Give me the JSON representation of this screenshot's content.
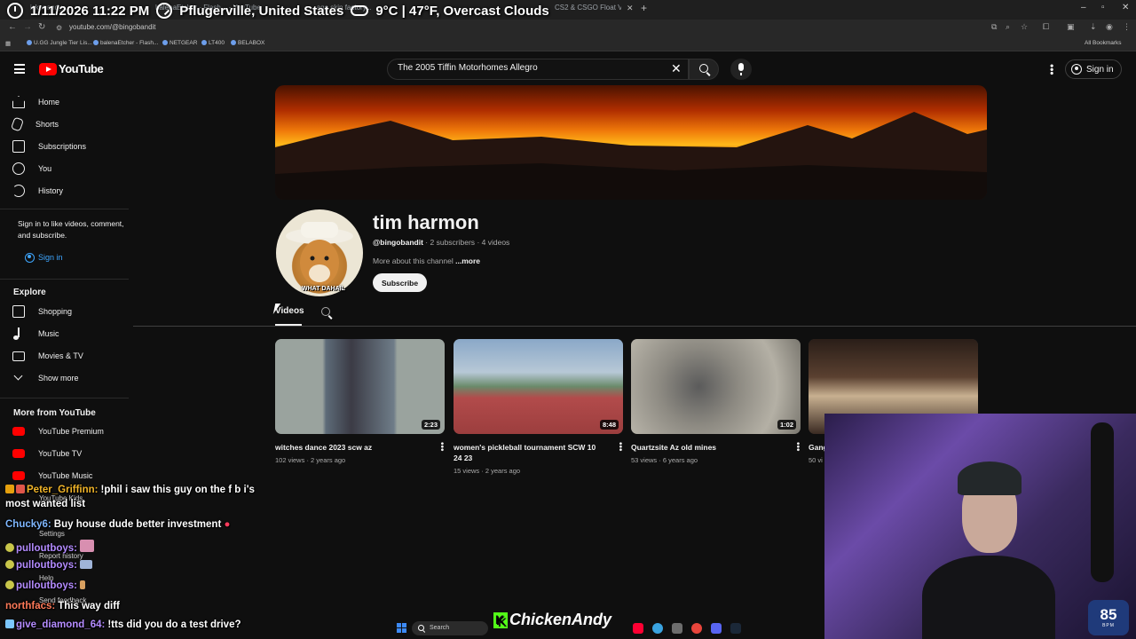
{
  "browser": {
    "url": "youtube.com/@bingobandit",
    "tab_fragments": [
      "ickenandy...",
      "balenaEtcher - Flash... - YouTube",
      "...ago skin factory...",
      "CS2 & CSGO Float Value A..."
    ],
    "bookmarks": [
      "U.GG Jungle Tier Lis...",
      "balenaEtcher - Flash...",
      "NETGEAR",
      "LT400",
      "BELABOX"
    ],
    "all_bookmarks": "All Bookmarks"
  },
  "overlay": {
    "datetime": "1/11/2026 11:22 PM",
    "location": "Pflugerville, United States",
    "weather": "9°C | 47°F, Overcast Clouds"
  },
  "header": {
    "logo_text": "YouTube",
    "search_value": "The 2005 Tiffin Motorhomes Allegro",
    "sign_in": "Sign in"
  },
  "sidebar": {
    "main": [
      {
        "label": "Home",
        "icon": "home-icon"
      },
      {
        "label": "Shorts",
        "icon": "shorts-icon"
      },
      {
        "label": "Subscriptions",
        "icon": "subscriptions-icon"
      },
      {
        "label": "You",
        "icon": "you-icon"
      },
      {
        "label": "History",
        "icon": "history-icon"
      }
    ],
    "signin_prompt": "Sign in to like videos, comment, and subscribe.",
    "signin_label": "Sign in",
    "explore_heading": "Explore",
    "explore": [
      {
        "label": "Shopping",
        "icon": "shopping-icon"
      },
      {
        "label": "Music",
        "icon": "music-icon"
      },
      {
        "label": "Movies & TV",
        "icon": "movies-icon"
      },
      {
        "label": "Show more",
        "icon": "chevron-down-icon"
      }
    ],
    "more_heading": "More from YouTube",
    "more": [
      {
        "label": "YouTube Premium"
      },
      {
        "label": "YouTube TV"
      },
      {
        "label": "YouTube Music"
      },
      {
        "label": "YouTube Kids"
      }
    ],
    "footer": [
      "Settings",
      "Report history",
      "Help",
      "Send feedback"
    ]
  },
  "channel": {
    "name": "tim harmon",
    "handle": "@bingobandit",
    "subscribers": "2 subscribers",
    "videos_count": "4 videos",
    "about": "More about this channel",
    "more_link": "...more",
    "subscribe": "Subscribe",
    "avatar_caption": "WHAT DAHAIL",
    "tab": "Videos"
  },
  "videos": [
    {
      "title": "witches dance 2023 scw az",
      "views": "102 views",
      "age": "2 years ago",
      "duration": "2:23"
    },
    {
      "title": "women's pickleball tournament SCW 10 24 23",
      "views": "15 views",
      "age": "2 years ago",
      "duration": "8:48"
    },
    {
      "title": "Quartzsite Az old mines",
      "views": "53 views",
      "age": "6 years ago",
      "duration": "1:02"
    },
    {
      "title": "Gang",
      "views": "50 vi",
      "age": "",
      "duration": ""
    }
  ],
  "chat": [
    {
      "user": "Peter_Griffinn:",
      "message": "!phil i saw this guy on the f b i's",
      "user_color": "#f0b429"
    },
    {
      "user": "",
      "message": "most wanted list",
      "user_color": "#ffffff"
    },
    {
      "user": "Chucky6:",
      "message": "Buy house dude better investment",
      "user_color": "#7fb7ff"
    },
    {
      "user": "pulloutboys:",
      "message": "",
      "user_color": "#b48cff"
    },
    {
      "user": "pulloutboys:",
      "message": "",
      "user_color": "#b48cff"
    },
    {
      "user": "pulloutboys:",
      "message": "",
      "user_color": "#b48cff"
    },
    {
      "user": "northfacs:",
      "message": "This way diff",
      "user_color": "#ff7a59"
    },
    {
      "user": "give_diamond_64:",
      "message": "!tts did you do a test drive?",
      "user_color": "#b48cff"
    }
  ],
  "stream": {
    "brand": "ChickenAndy",
    "bpm_value": "85",
    "bpm_unit": "BPM"
  },
  "taskbar": {
    "search": "Search"
  }
}
